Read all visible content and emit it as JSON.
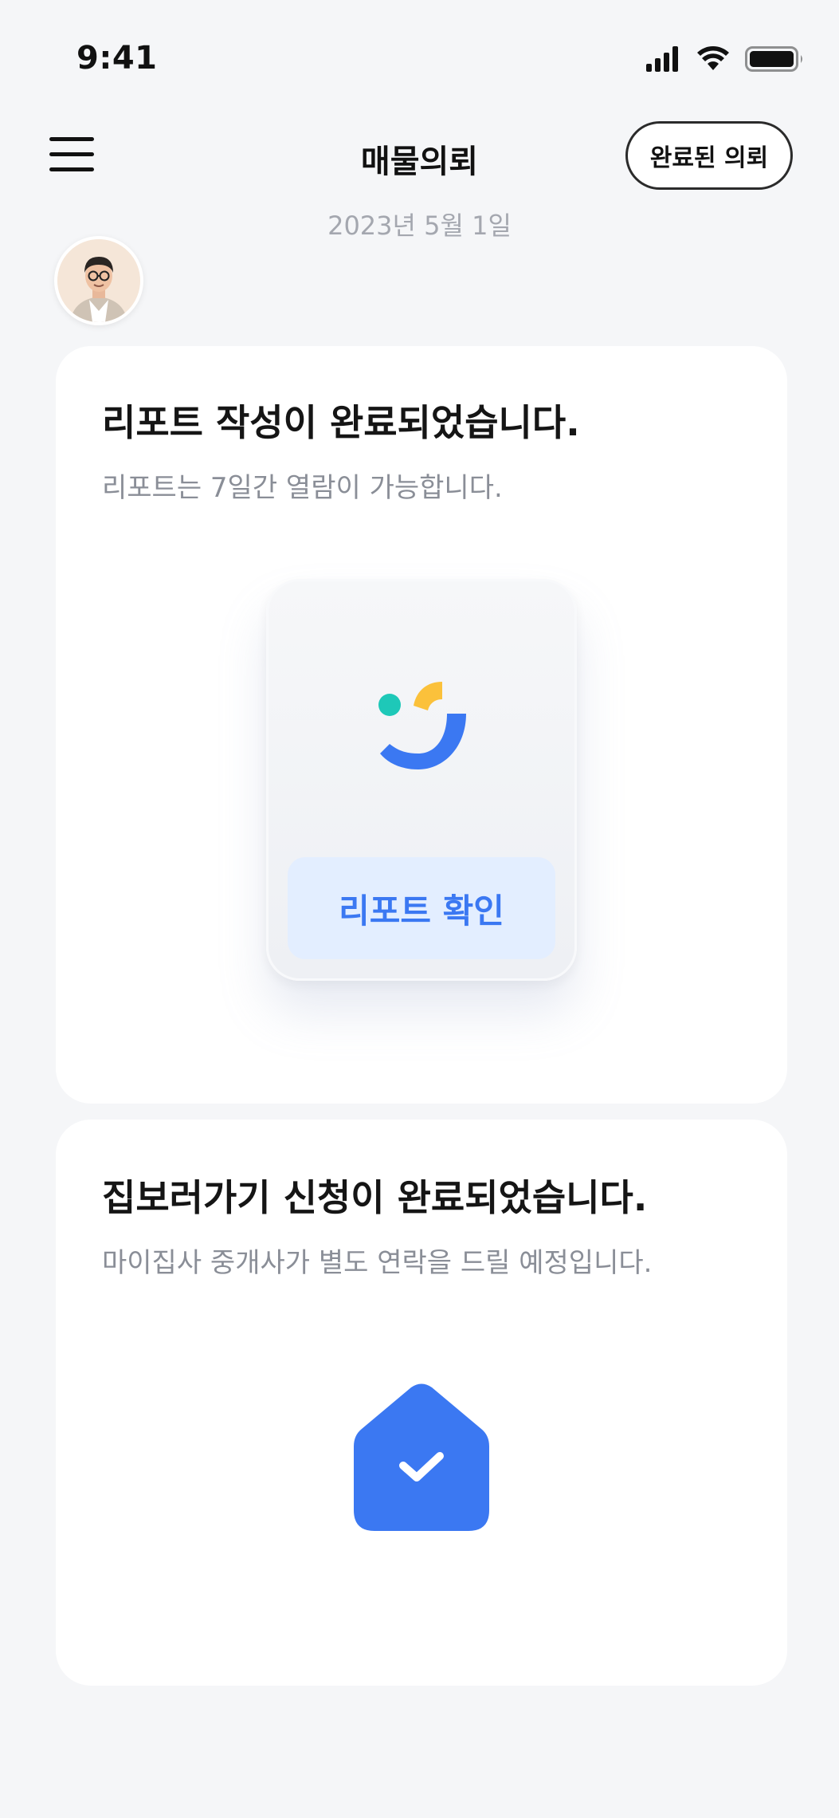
{
  "status_bar": {
    "time": "9:41",
    "icons": [
      "signal-icon",
      "wifi-icon",
      "battery-icon"
    ]
  },
  "header": {
    "title": "매물의뢰",
    "completed_button_label": "완료된 의뢰",
    "menu_icon": "hamburger-menu-icon"
  },
  "date_label": "2023년 5월 1일",
  "cards": {
    "report": {
      "title": "리포트 작성이 완료되었습니다.",
      "subtitle": "리포트는 7일간 열람이 가능합니다.",
      "button_label": "리포트 확인",
      "logo_icon": "smile-logo-icon"
    },
    "visit": {
      "title": "집보러가기 신청이 완료되었습니다.",
      "subtitle": "마이집사 중개사가 별도 연락을 드릴 예정입니다.",
      "icon": "house-check-icon"
    }
  },
  "colors": {
    "accent": "#3b78f2",
    "accent_light": "#e3eeff",
    "logo_teal": "#1ec8b8",
    "logo_yellow": "#fbc13b",
    "background": "#f5f6f8",
    "muted_text": "#8a8e97"
  }
}
